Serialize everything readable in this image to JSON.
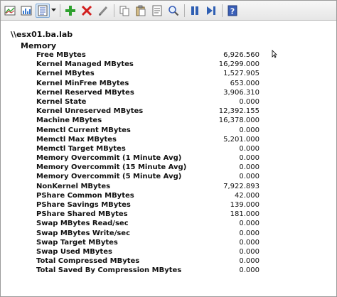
{
  "toolbar": {
    "icons": [
      "view-graph-icon",
      "view-histogram-icon",
      "view-report-icon",
      "add-counter-icon",
      "delete-counter-icon",
      "highlight-icon",
      "copy-properties-icon",
      "paste-counter-list-icon",
      "properties-icon",
      "zoom-icon",
      "freeze-display-icon",
      "update-data-icon",
      "help-icon"
    ]
  },
  "report": {
    "host": "\\\\esx01.ba.lab",
    "object": "Memory",
    "counters": [
      {
        "name": "Free MBytes",
        "value": "6,926.560"
      },
      {
        "name": "Kernel Managed MBytes",
        "value": "16,299.000"
      },
      {
        "name": "Kernel MBytes",
        "value": "1,527.905"
      },
      {
        "name": "Kernel MinFree MBytes",
        "value": "653.000"
      },
      {
        "name": "Kernel Reserved MBytes",
        "value": "3,906.310"
      },
      {
        "name": "Kernel State",
        "value": "0.000"
      },
      {
        "name": "Kernel Unreserved MBytes",
        "value": "12,392.155"
      },
      {
        "name": "Machine MBytes",
        "value": "16,378.000"
      },
      {
        "name": "Memctl Current MBytes",
        "value": "0.000"
      },
      {
        "name": "Memctl Max MBytes",
        "value": "5,201.000"
      },
      {
        "name": "Memctl Target MBytes",
        "value": "0.000"
      },
      {
        "name": "Memory Overcommit (1 Minute Avg)",
        "value": "0.000"
      },
      {
        "name": "Memory Overcommit (15 Minute Avg)",
        "value": "0.000"
      },
      {
        "name": "Memory Overcommit (5 Minute Avg)",
        "value": "0.000"
      },
      {
        "name": "NonKernel MBytes",
        "value": "7,922.893"
      },
      {
        "name": "PShare Common MBytes",
        "value": "42.000"
      },
      {
        "name": "PShare Savings MBytes",
        "value": "139.000"
      },
      {
        "name": "PShare Shared MBytes",
        "value": "181.000"
      },
      {
        "name": "Swap MBytes Read/sec",
        "value": "0.000"
      },
      {
        "name": "Swap MBytes Write/sec",
        "value": "0.000"
      },
      {
        "name": "Swap Target MBytes",
        "value": "0.000"
      },
      {
        "name": "Swap Used MBytes",
        "value": "0.000"
      },
      {
        "name": "Total Compressed MBytes",
        "value": "0.000"
      },
      {
        "name": "Total Saved By Compression MBytes",
        "value": "0.000"
      }
    ]
  },
  "colors": {
    "add": "#2fa12f",
    "delete": "#d21f1f",
    "blue": "#2f5fb3",
    "help_bg": "#3a5fb8"
  }
}
